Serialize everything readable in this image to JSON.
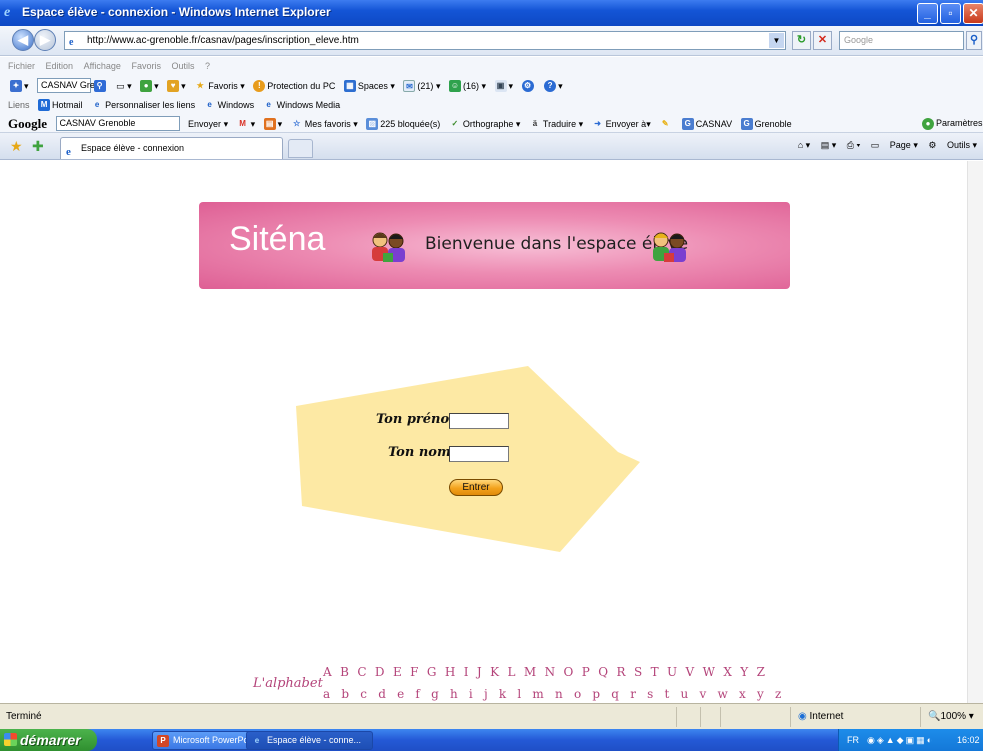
{
  "window": {
    "title": "Espace élève - connexion - Windows Internet Explorer",
    "minimize": "_",
    "maximize": "▫",
    "close": "✕"
  },
  "address_bar": {
    "url": "http://www.ac-grenoble.fr/casnav/pages/inscription_eleve.htm",
    "search_placeholder": "Google"
  },
  "menu": [
    "Fichier",
    "Edition",
    "Affichage",
    "Favoris",
    "Outils",
    "?"
  ],
  "winlive_toolbar": {
    "search_box": "CASNAV Grer",
    "favoris": "Favoris",
    "protection": "Protection du PC",
    "spaces": "Spaces",
    "mail_count": "(21)",
    "contacts_count": "(16)"
  },
  "links_toolbar": {
    "label": "Liens",
    "items": [
      "Hotmail",
      "Personnaliser les liens",
      "Windows",
      "Windows Media"
    ]
  },
  "google_toolbar": {
    "logo": "Google",
    "search_value": "CASNAV Grenoble",
    "envoyer": "Envoyer",
    "mes_favoris": "Mes favoris",
    "blocked": "225 bloquée(s)",
    "orthographe": "Orthographe",
    "traduire": "Traduire",
    "envoyer_a": "Envoyer à",
    "casnav": "CASNAV",
    "grenoble": "Grenoble",
    "parametres": "Paramètres"
  },
  "tab": {
    "title": "Espace élève - connexion"
  },
  "command_bar": {
    "page": "Page",
    "outils": "Outils"
  },
  "page": {
    "logo": "Siténa",
    "welcome": "Bienvenue dans l'espace élève",
    "form": {
      "prenom_label": "Ton prénom",
      "nom_label": "Ton nom",
      "prenom_value": "",
      "nom_value": "",
      "submit": "Entrer"
    },
    "alphabet_logo": "L'alphabet",
    "upper": "A B C D E F G H I J K L M N O P Q R S T U V W X Y Z",
    "lower": "a b c d e f g h i j k l m n o p q r s t u v w x y z"
  },
  "status_bar": {
    "status": "Terminé",
    "zone": "Internet",
    "zoom": "100%"
  },
  "taskbar": {
    "start": "démarrer",
    "tasks": [
      "Microsoft PowerPoint ...",
      "Espace élève - conne..."
    ],
    "lang": "FR",
    "clock": "16:02"
  },
  "colors": {
    "banner_pink": "#ed8cb3",
    "arrow_yellow": "#fde9a4",
    "alphabet": "#b4447a",
    "button_orange": "#f3a21c"
  }
}
